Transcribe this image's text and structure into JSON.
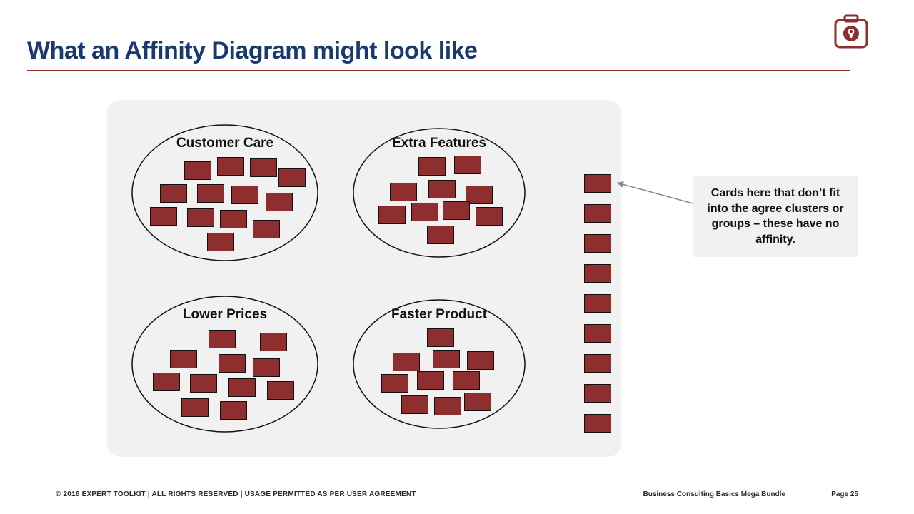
{
  "title": "What an Affinity Diagram might look like",
  "logo_name": "toolkit-briefcase-wrench-icon",
  "clusters": [
    {
      "label": "Customer Care",
      "card_count": 13
    },
    {
      "label": "Extra Features",
      "card_count": 10
    },
    {
      "label": "Lower Prices",
      "card_count": 11
    },
    {
      "label": "Faster Product",
      "card_count": 10
    }
  ],
  "loose_cards": 9,
  "callout": "Cards here that don’t fit into the agree clusters or groups – these have no affinity.",
  "footer": {
    "left": "© 2018 EXPERT TOOLKIT | ALL RIGHTS RESERVED | USAGE PERMITTED AS PER USER AGREEMENT",
    "mid": "Business Consulting Basics Mega Bundle",
    "right": "Page 25"
  },
  "colors": {
    "brand_navy": "#1a3a6e",
    "brand_maroon": "#8e2e2e",
    "panel_gray": "#f1f1f1"
  }
}
